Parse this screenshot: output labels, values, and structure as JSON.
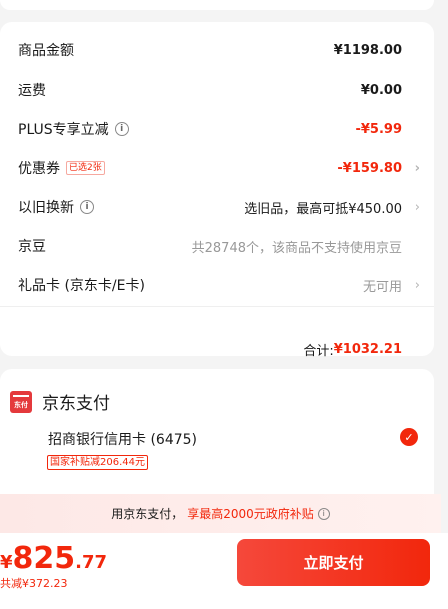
{
  "fees": {
    "goods_amount": {
      "label": "商品金额",
      "value": "¥1198.00"
    },
    "shipping": {
      "label": "运费",
      "value": "¥0.00"
    },
    "plus_discount": {
      "label": "PLUS专享立减",
      "value": "-¥5.99"
    },
    "coupon": {
      "label": "优惠券",
      "badge": "已选2张",
      "value": "-¥159.80"
    },
    "trade_in": {
      "label": "以旧换新",
      "value": "选旧品，最高可抵¥450.00"
    },
    "jd_beans": {
      "label": "京豆",
      "value": "共28748个，该商品不支持使用京豆"
    },
    "gift_card": {
      "label": "礼品卡 (京东卡/E卡)",
      "value": "无可用"
    },
    "total": {
      "label": "合计:",
      "value": "¥1032.21"
    }
  },
  "payment": {
    "title": "京东支付",
    "icon_text": "东付",
    "card_name": "招商银行信用卡 (6475)",
    "subsidy_tag": "国家补贴减206.44元",
    "selected": true
  },
  "promo": {
    "prefix": "用京东支付，",
    "highlight": "享最高2000元政府补贴"
  },
  "footer": {
    "price_symbol": "¥",
    "price_int": "825",
    "price_dec": ".77",
    "saved": "共减¥372.23",
    "pay_button": "立即支付"
  },
  "colors": {
    "accent": "#f2270c",
    "background": "#f4f4f4"
  },
  "icons": {
    "info": "info-circle-icon",
    "chevron": "chevron-right-icon",
    "check": "check-circle-icon",
    "jd_pay": "jd-pay-icon"
  }
}
